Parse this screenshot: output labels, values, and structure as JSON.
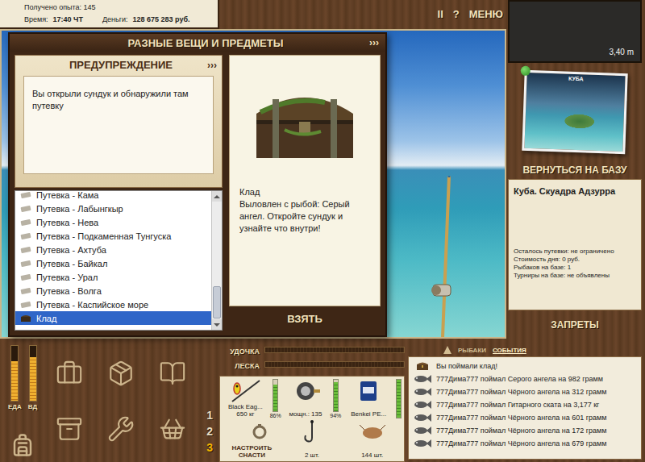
{
  "status": {
    "experience": "Получено опыта: 145",
    "time_label": "Время:",
    "time": "17:40 ЧТ",
    "money_label": "Деньги:",
    "money": "128 675 283 руб."
  },
  "toolbar": [
    "II",
    "?",
    "МЕНЮ"
  ],
  "depth": "3,40 m",
  "items_window": {
    "title": "РАЗНЫЕ ВЕЩИ И ПРЕДМЕТЫ",
    "expand": "›››",
    "warning": {
      "title": "ПРЕДУПРЕЖДЕНИЕ",
      "expand": "›››",
      "text": "Вы открыли сундук и обнаружили там путевку"
    },
    "list": [
      {
        "label": "Путевка - Кама",
        "kind": "ticket",
        "selected": false
      },
      {
        "label": "Путевка - Лабынгкыр",
        "kind": "ticket",
        "selected": false
      },
      {
        "label": "Путевка - Нева",
        "kind": "ticket",
        "selected": false
      },
      {
        "label": "Путевка - Подкаменная Тунгуска",
        "kind": "ticket",
        "selected": false
      },
      {
        "label": "Путевка - Ахтуба",
        "kind": "ticket",
        "selected": false
      },
      {
        "label": "Путевка - Байкал",
        "kind": "ticket",
        "selected": false
      },
      {
        "label": "Путевка - Урал",
        "kind": "ticket",
        "selected": false
      },
      {
        "label": "Путевка - Волга",
        "kind": "ticket",
        "selected": false
      },
      {
        "label": "Путевка - Каспийское море",
        "kind": "ticket",
        "selected": false
      },
      {
        "label": "Клад",
        "kind": "treasure",
        "selected": true
      }
    ],
    "list_scroll": 1,
    "detail": {
      "name": "Клад",
      "description": "Выловлен с рыбой: Серый ангел. Откройте сундук и узнайте что внутри!"
    },
    "take_button": "ВЗЯТЬ"
  },
  "base": {
    "map_label": "КУБА",
    "return_button": "ВЕРНУТЬСЯ НА БАЗУ",
    "name": "Куба. Скуадра Адзурра",
    "facts": [
      "Осталось путевки: не ограничено",
      "Стоимость дня: 0 руб.",
      "Рыбаков на базе: 1",
      "Турниры на базе: не объявлены"
    ],
    "bans_button": "ЗАПРЕТЫ"
  },
  "needs": [
    {
      "label": "ЕДА",
      "level": 0.72
    },
    {
      "label": "ВД",
      "level": 0.8
    }
  ],
  "tackle_sets": [
    {
      "label": "1",
      "selected": false
    },
    {
      "label": "2",
      "selected": false
    },
    {
      "label": "3",
      "selected": true
    }
  ],
  "tension": [
    {
      "label": "УДОЧКА",
      "level": 0
    },
    {
      "label": "ЛЕСКА",
      "level": 0
    }
  ],
  "tackle": [
    {
      "kind": "rod",
      "lines": [
        "Black Eag...",
        "650 кг"
      ],
      "wear": "86%",
      "level": 0.86
    },
    {
      "kind": "reel",
      "lines": [
        "мощн.: 135"
      ],
      "wear": "94%",
      "level": 0.94
    },
    {
      "kind": "line",
      "lines": [
        "Benkei PE..."
      ],
      "level": 1
    },
    {
      "kind": "setup",
      "lines": [
        "НАСТРОИТЬ СНАСТИ"
      ]
    },
    {
      "kind": "hook",
      "lines": [
        "2 шт."
      ]
    },
    {
      "kind": "bait",
      "lines": [
        "144 шт."
      ]
    }
  ],
  "log_tabs": [
    {
      "label": "РЫБАКИ",
      "selected": false
    },
    {
      "label": "СОБЫТИЯ",
      "selected": true
    }
  ],
  "events": [
    {
      "kind": "treasure",
      "text": "Вы поймали клад!"
    },
    {
      "kind": "fish",
      "text": "777Дима777 поймал Серого ангела на 982 грамм"
    },
    {
      "kind": "fish",
      "text": "777Дима777 поймал Чёрного ангела на 312 грамм"
    },
    {
      "kind": "fish",
      "text": "777Дима777 поймал Гитарного ската на 3,177 кг"
    },
    {
      "kind": "fish",
      "text": "777Дима777 поймал Чёрного ангела на 601 грамм"
    },
    {
      "kind": "fish",
      "text": "777Дима777 поймал Чёрного ангела на 172 грамм"
    },
    {
      "kind": "fish",
      "text": "777Дима777 поймал Чёрного ангела на 679 грамм"
    }
  ]
}
